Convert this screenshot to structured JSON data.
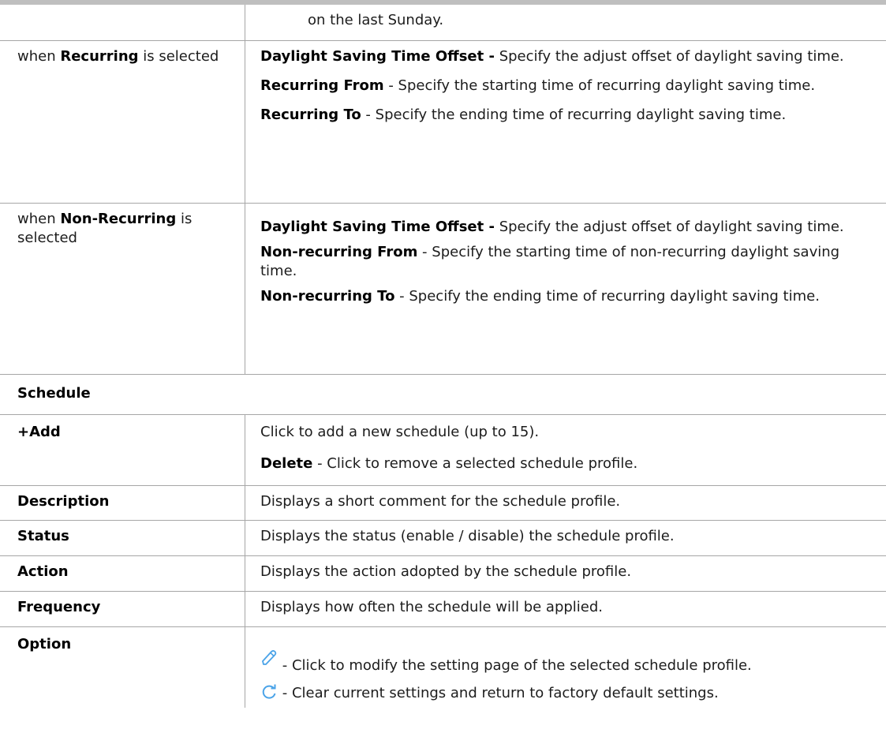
{
  "colors": {
    "border": "#a6a6a6",
    "icon": "#4aa3e8",
    "top_bar": "#bfbfbf"
  },
  "top_row": {
    "text": "on the last Sunday."
  },
  "recurring": {
    "left_prefix": "when ",
    "left_bold": "Recurring",
    "left_suffix": " is selected",
    "items": [
      {
        "title": "Daylight Saving Time Offset -",
        "text": " Specify the adjust offset of daylight saving time."
      },
      {
        "title": "Recurring From",
        "text": " - Specify the starting time of recurring daylight saving time."
      },
      {
        "title": "Recurring To",
        "text": " - Specify the ending time of recurring daylight saving time."
      }
    ]
  },
  "non_recurring": {
    "left_prefix": "when ",
    "left_bold": "Non-Recurring",
    "left_suffix": " is selected",
    "items": [
      {
        "title": "Daylight Saving Time Offset -",
        "text": " Specify the adjust offset of daylight saving time."
      },
      {
        "title": "Non-recurring From",
        "text": " - Specify the starting time of non-recurring daylight saving time."
      },
      {
        "title": "Non-recurring To",
        "text": " - Specify the ending time of recurring daylight saving time."
      }
    ]
  },
  "schedule_heading": "Schedule",
  "schedule_rows": {
    "add": {
      "label": "+Add",
      "line1": "Click to add a new schedule (up to 15).",
      "delete_title": "Delete",
      "delete_text": " - Click to remove a selected schedule profile."
    },
    "description": {
      "label": "Description",
      "text": "Displays a short comment for the schedule profile."
    },
    "status": {
      "label": "Status",
      "text": "Displays the status (enable / disable) the schedule profile."
    },
    "action": {
      "label": "Action",
      "text": "Displays the action adopted by the schedule profile."
    },
    "frequency": {
      "label": "Frequency",
      "text": "Displays how often the schedule will be applied."
    },
    "option": {
      "label": "Option",
      "edit_icon": "pencil-icon",
      "edit_text": " - Click to modify the setting page of the selected schedule profile.",
      "reset_icon": "refresh-icon",
      "reset_text": " - Clear current settings and return to factory default settings."
    }
  }
}
